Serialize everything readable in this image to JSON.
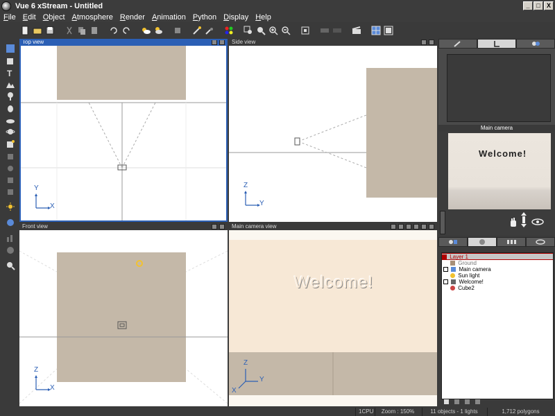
{
  "window": {
    "title": "Vue 6 xStream - Untitled",
    "min": "_",
    "max": "□",
    "close": "X"
  },
  "menu": [
    "File",
    "Edit",
    "Object",
    "Atmosphere",
    "Render",
    "Animation",
    "Python",
    "Display",
    "Help"
  ],
  "viewports": {
    "top": {
      "title": "Top view",
      "axes": [
        "Y",
        "X"
      ]
    },
    "side": {
      "title": "Side view",
      "axes": [
        "Z",
        "Y"
      ]
    },
    "front": {
      "title": "Front view",
      "axes": [
        "Z",
        "X"
      ]
    },
    "camera": {
      "title": "Main camera view",
      "text": "Welcome!",
      "axes": [
        "Z",
        "Y",
        "X"
      ]
    }
  },
  "preview": {
    "title": "Main camera",
    "text": "Welcome!"
  },
  "layers": {
    "rows": [
      {
        "label": "Layer 1",
        "type": "layer"
      },
      {
        "label": "Ground",
        "type": "dim"
      },
      {
        "label": "Main camera",
        "type": "item"
      },
      {
        "label": "Sun light",
        "type": "item"
      },
      {
        "label": "Welcome!",
        "type": "item"
      },
      {
        "label": "Cube2",
        "type": "item"
      }
    ]
  },
  "status": {
    "cpu": "1CPU",
    "zoom": "Zoom : 150%",
    "objects": "11 objects - 1 lights",
    "polygons": "1,712 polygons"
  },
  "colors": {
    "accent": "#2b5fb5",
    "object": "#c4b8a8",
    "camera_bg": "#f7e8d6",
    "layer_text": "#b00000"
  }
}
